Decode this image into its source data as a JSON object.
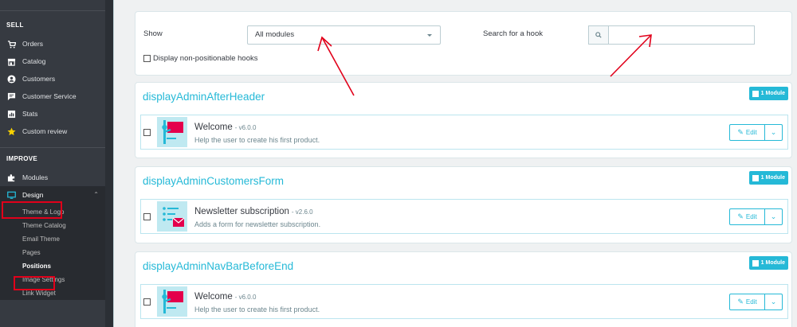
{
  "sidebar": {
    "sections": [
      {
        "title": "SELL",
        "items": [
          {
            "label": "Orders",
            "icon": "cart-icon"
          },
          {
            "label": "Catalog",
            "icon": "store-icon"
          },
          {
            "label": "Customers",
            "icon": "user-icon"
          },
          {
            "label": "Customer Service",
            "icon": "chat-icon"
          },
          {
            "label": "Stats",
            "icon": "stats-icon"
          },
          {
            "label": "Custom review",
            "icon": "star-icon"
          }
        ]
      },
      {
        "title": "IMPROVE",
        "items": [
          {
            "label": "Modules",
            "icon": "puzzle-icon"
          },
          {
            "label": "Design",
            "icon": "monitor-icon",
            "expanded": true
          }
        ]
      }
    ],
    "design_subitems": [
      "Theme & Logo",
      "Theme Catalog",
      "Email Theme",
      "Pages",
      "Positions",
      "Image Settings",
      "Link Widget"
    ],
    "current_subitem": "Positions"
  },
  "filters": {
    "show_label": "Show",
    "show_value": "All modules",
    "search_label": "Search for a hook",
    "search_value": "",
    "non_positionable_label": "Display non-positionable hooks"
  },
  "hooks": [
    {
      "name": "displayAdminAfterHeader",
      "badge": "1 Module",
      "module": {
        "name": "Welcome",
        "version": "- v6.0.0",
        "description": "Help the user to create his first product.",
        "icon": "welcome-module-icon"
      },
      "edit_label": "Edit"
    },
    {
      "name": "displayAdminCustomersForm",
      "badge": "1 Module",
      "module": {
        "name": "Newsletter subscription",
        "version": "- v2.6.0",
        "description": "Adds a form for newsletter subscription.",
        "icon": "newsletter-module-icon"
      },
      "edit_label": "Edit"
    },
    {
      "name": "displayAdminNavBarBeforeEnd",
      "badge": "1 Module",
      "module": {
        "name": "Welcome",
        "version": "- v6.0.0",
        "description": "Help the user to create his first product.",
        "icon": "welcome-module-icon"
      },
      "edit_label": "Edit"
    }
  ],
  "colors": {
    "accent": "#25b9d7",
    "sidebar_bg": "#363a41",
    "annotation_red": "#e1001a"
  }
}
